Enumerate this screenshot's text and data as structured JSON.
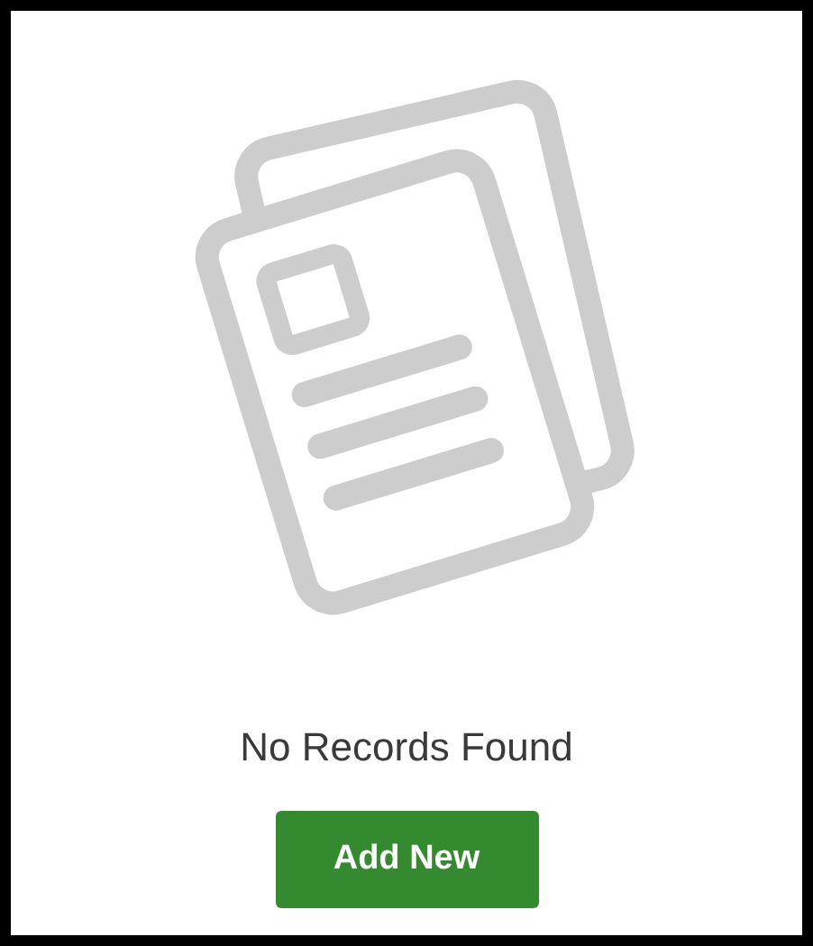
{
  "empty_state": {
    "message": "No Records Found",
    "button": {
      "label": "Add New"
    }
  }
}
